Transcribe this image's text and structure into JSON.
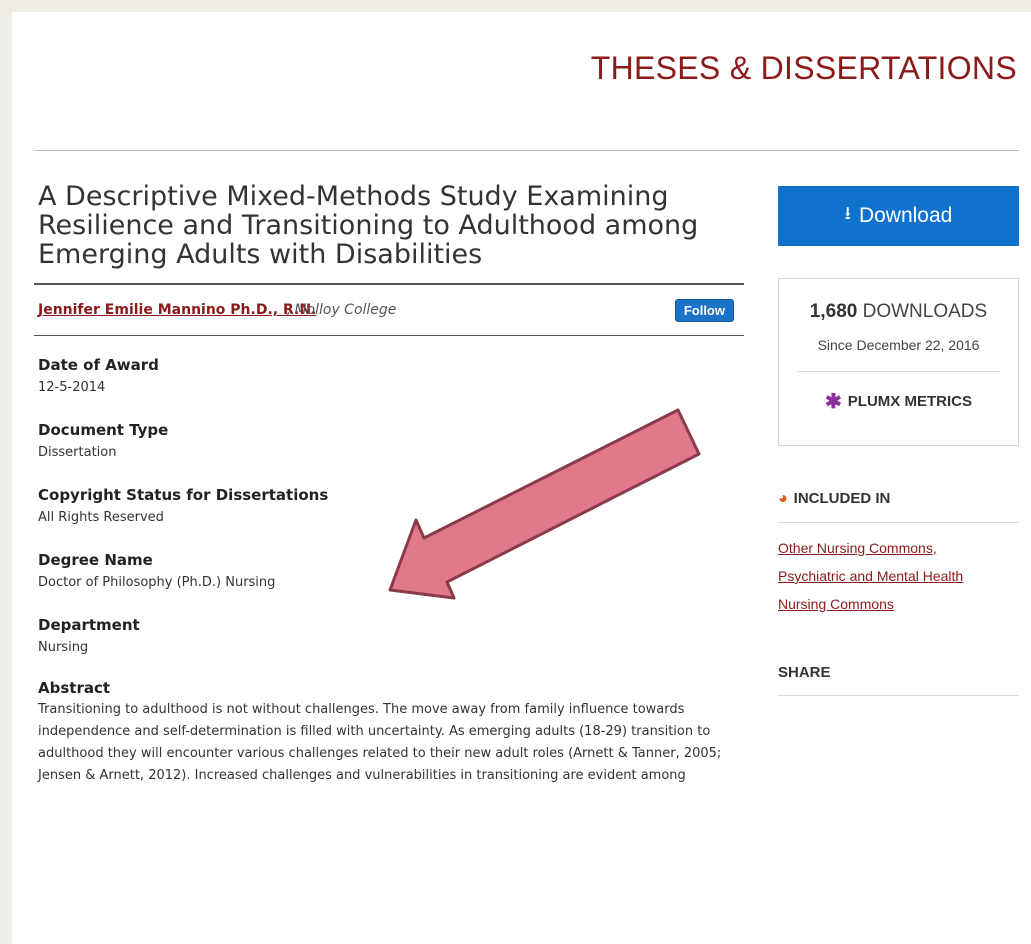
{
  "header": {
    "section_title": "THESES & DISSERTATIONS"
  },
  "document": {
    "title": "A Descriptive Mixed-Methods Study Examining Resilience and Transitioning to Adulthood among Emerging Adults with Disabilities",
    "author_name": "Jennifer Emilie Mannino Ph.D., R.N.",
    "author_separator": ",",
    "author_affiliation": "Molloy College",
    "follow_label": "Follow",
    "fields": [
      {
        "label": "Date of Award",
        "value": "12-5-2014"
      },
      {
        "label": "Document Type",
        "value": "Dissertation"
      },
      {
        "label": "Copyright Status for Dissertations",
        "value": "All Rights Reserved"
      },
      {
        "label": "Degree Name",
        "value": "Doctor of Philosophy (Ph.D.) Nursing"
      },
      {
        "label": "Department",
        "value": "Nursing"
      }
    ],
    "abstract_label": "Abstract",
    "abstract_text": "Transitioning to adulthood is not without challenges. The move away from family influence towards independence and self-determination is filled with uncertainty. As emerging adults (18-29) transition to adulthood they will encounter various challenges related to their new adult roles (Arnett & Tanner, 2005; Jensen & Arnett, 2012). Increased challenges and vulnerabilities in transitioning are evident among"
  },
  "sidebar": {
    "download_label": "Download",
    "download_count": "1,680",
    "downloads_word": "DOWNLOADS",
    "since_text": "Since December 22, 2016",
    "plumx_label": "PLUMX METRICS",
    "included_label": "INCLUDED IN",
    "commons": [
      "Other Nursing Commons,",
      "Psychiatric and Mental Health",
      "Nursing Commons"
    ],
    "share_label": "SHARE"
  },
  "colors": {
    "brand_red": "#8b1a1a",
    "download_blue": "#0f72cc",
    "arrow_fill": "#e07a8a",
    "arrow_stroke": "#8b3a4a"
  }
}
